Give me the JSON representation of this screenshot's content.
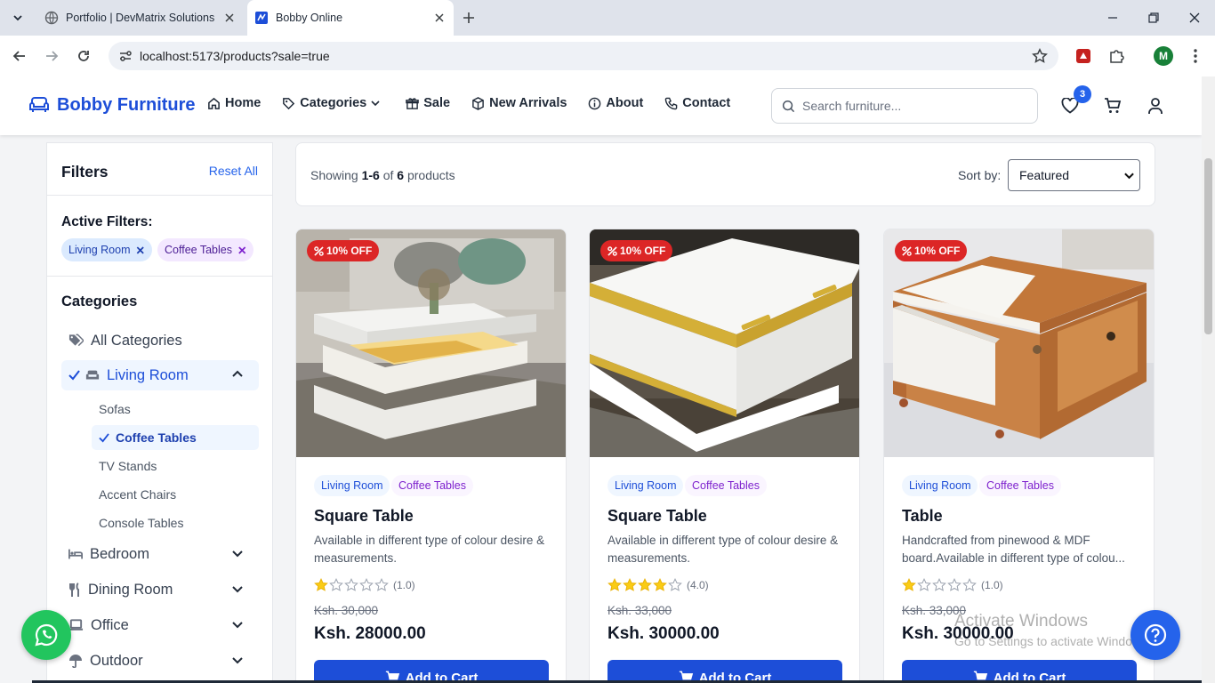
{
  "browser": {
    "tabs": [
      {
        "title": "Portfolio | DevMatrix Solutions",
        "active": false
      },
      {
        "title": "Bobby Online",
        "active": true
      }
    ],
    "url": "localhost:5173/products?sale=true",
    "profile_initial": "M"
  },
  "header": {
    "brand": "Bobby Furniture",
    "nav": [
      {
        "label": "Home",
        "icon": "home-icon"
      },
      {
        "label": "Categories",
        "icon": "tag-icon"
      },
      {
        "label": "Sale",
        "icon": "gift-icon"
      },
      {
        "label": "New Arrivals",
        "icon": "box-icon"
      },
      {
        "label": "About",
        "icon": "info-icon"
      },
      {
        "label": "Contact",
        "icon": "phone-icon"
      }
    ],
    "search_placeholder": "Search furniture...",
    "wishlist_count": "3"
  },
  "filters": {
    "title": "Filters",
    "reset": "Reset All",
    "active_label": "Active Filters:",
    "active": [
      "Living Room",
      "Coffee Tables"
    ],
    "categories_title": "Categories",
    "categories": [
      {
        "label": "All Categories",
        "icon": "tags-icon"
      },
      {
        "label": "Living Room",
        "icon": "sofa-icon",
        "expanded": true,
        "selected": true,
        "subs": [
          "Sofas",
          "Coffee Tables",
          "TV Stands",
          "Accent Chairs",
          "Console Tables"
        ],
        "selected_sub": "Coffee Tables"
      },
      {
        "label": "Bedroom",
        "icon": "bed-icon"
      },
      {
        "label": "Dining Room",
        "icon": "utensils-icon"
      },
      {
        "label": "Office",
        "icon": "laptop-icon"
      },
      {
        "label": "Outdoor",
        "icon": "umbrella-icon"
      }
    ]
  },
  "listing": {
    "showing_prefix": "Showing ",
    "range": "1-6",
    "of": " of ",
    "total": "6",
    "suffix": " products",
    "sort_label": "Sort by:",
    "sort_value": "Featured"
  },
  "products": [
    {
      "badge": "10% OFF",
      "tags": [
        "Living Room",
        "Coffee Tables"
      ],
      "name": "Square Table",
      "desc": "Available in different type of colour desire & measurements.",
      "rating": 1,
      "rating_text": "(1.0)",
      "old_price": "Ksh. 30,000",
      "price": "Ksh. 28000.00",
      "cta": "Add to Cart"
    },
    {
      "badge": "10% OFF",
      "tags": [
        "Living Room",
        "Coffee Tables"
      ],
      "name": "Square Table",
      "desc": "Available in different type of colour desire & measurements.",
      "rating": 4,
      "rating_text": "(4.0)",
      "old_price": "Ksh. 33,000",
      "price": "Ksh. 30000.00",
      "cta": "Add to Cart"
    },
    {
      "badge": "10% OFF",
      "tags": [
        "Living Room",
        "Coffee Tables"
      ],
      "name": "Table",
      "desc": "Handcrafted from pinewood & MDF board.Available in different type of colou...",
      "rating": 1,
      "rating_text": "(1.0)",
      "old_price": "Ksh. 33,000",
      "price": "Ksh. 30000.00",
      "cta": "Add to Cart"
    }
  ],
  "os_watermark": {
    "line1": "Activate Windows",
    "line2": "Go to Settings to activate Windows."
  },
  "colors": {
    "primary": "#1d4ed8",
    "sale": "#dc2626",
    "star": "#facc15",
    "whatsapp": "#22c55e"
  }
}
